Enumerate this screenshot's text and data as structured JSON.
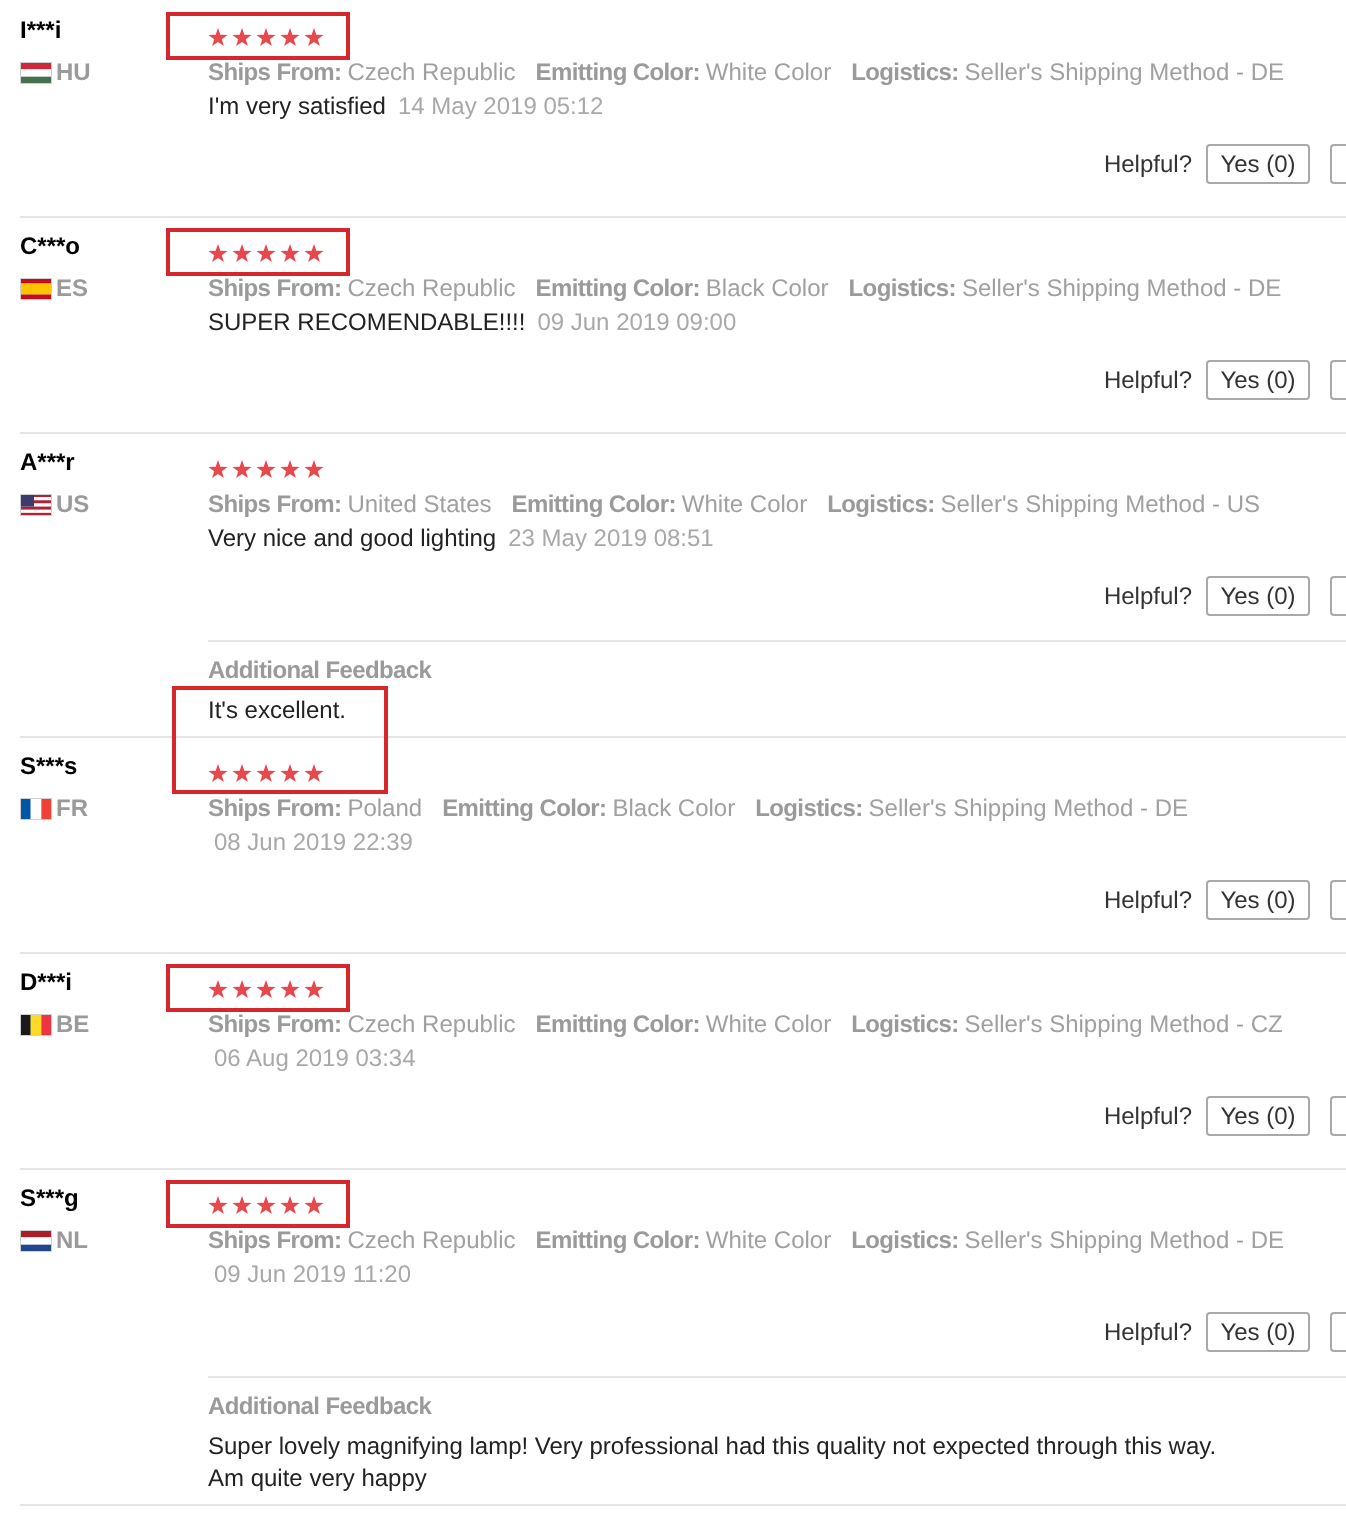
{
  "reviews": [
    {
      "name": "I***i",
      "country": "HU",
      "flag": {
        "kind": "hungary"
      },
      "stars": 5,
      "boxed": true,
      "attributes": [
        {
          "label": "Ships From:",
          "value": "Czech Republic"
        },
        {
          "label": "Emitting Color:",
          "value": "White Color"
        },
        {
          "label": "Logistics:",
          "value": "Seller's Shipping Method - DE"
        }
      ],
      "comment": "I'm very satisfied",
      "date": "14 May 2019 05:12",
      "helpful_label": "Helpful?",
      "yes_button": "Yes (0)"
    },
    {
      "name": "C***o",
      "country": "ES",
      "flag": {
        "kind": "spain"
      },
      "stars": 5,
      "boxed": true,
      "attributes": [
        {
          "label": "Ships From:",
          "value": "Czech Republic"
        },
        {
          "label": "Emitting Color:",
          "value": "Black Color"
        },
        {
          "label": "Logistics:",
          "value": "Seller's Shipping Method - DE"
        }
      ],
      "comment": "SUPER RECOMENDABLE!!!!",
      "date": "09 Jun 2019 09:00",
      "helpful_label": "Helpful?",
      "yes_button": "Yes (0)"
    },
    {
      "name": "A***r",
      "country": "US",
      "flag": {
        "kind": "usa"
      },
      "stars": 5,
      "boxed": false,
      "attributes": [
        {
          "label": "Ships From:",
          "value": "United States"
        },
        {
          "label": "Emitting Color:",
          "value": "White Color"
        },
        {
          "label": "Logistics:",
          "value": "Seller's Shipping Method - US"
        }
      ],
      "comment": "Very nice and good lighting",
      "date": "23 May 2019 08:51",
      "helpful_label": "Helpful?",
      "yes_button": "Yes (0)",
      "additional_feedback": {
        "label": "Additional Feedback",
        "text": "It's excellent.",
        "boxed": true
      }
    },
    {
      "name": "S***s",
      "country": "FR",
      "flag": {
        "kind": "france"
      },
      "stars": 5,
      "boxed": false,
      "attributes": [
        {
          "label": "Ships From:",
          "value": "Poland"
        },
        {
          "label": "Emitting Color:",
          "value": "Black Color"
        },
        {
          "label": "Logistics:",
          "value": "Seller's Shipping Method - DE"
        }
      ],
      "date": "08 Jun 2019 22:39",
      "helpful_label": "Helpful?",
      "yes_button": "Yes (0)"
    },
    {
      "name": "D***i",
      "country": "BE",
      "flag": {
        "kind": "belgium"
      },
      "stars": 5,
      "boxed": true,
      "attributes": [
        {
          "label": "Ships From:",
          "value": "Czech Republic"
        },
        {
          "label": "Emitting Color:",
          "value": "White Color"
        },
        {
          "label": "Logistics:",
          "value": "Seller's Shipping Method - CZ"
        }
      ],
      "date": "06 Aug 2019 03:34",
      "helpful_label": "Helpful?",
      "yes_button": "Yes (0)"
    },
    {
      "name": "S***g",
      "country": "NL",
      "flag": {
        "kind": "netherlands"
      },
      "stars": 5,
      "boxed": true,
      "attributes": [
        {
          "label": "Ships From:",
          "value": "Czech Republic"
        },
        {
          "label": "Emitting Color:",
          "value": "White Color"
        },
        {
          "label": "Logistics:",
          "value": "Seller's Shipping Method - DE"
        }
      ],
      "date": "09 Jun 2019 11:20",
      "helpful_label": "Helpful?",
      "yes_button": "Yes (0)",
      "additional_feedback": {
        "label": "Additional Feedback",
        "text": "Super lovely magnifying lamp! Very professional had this quality not expected through this way. Am quite very happy",
        "boxed": false
      }
    }
  ]
}
